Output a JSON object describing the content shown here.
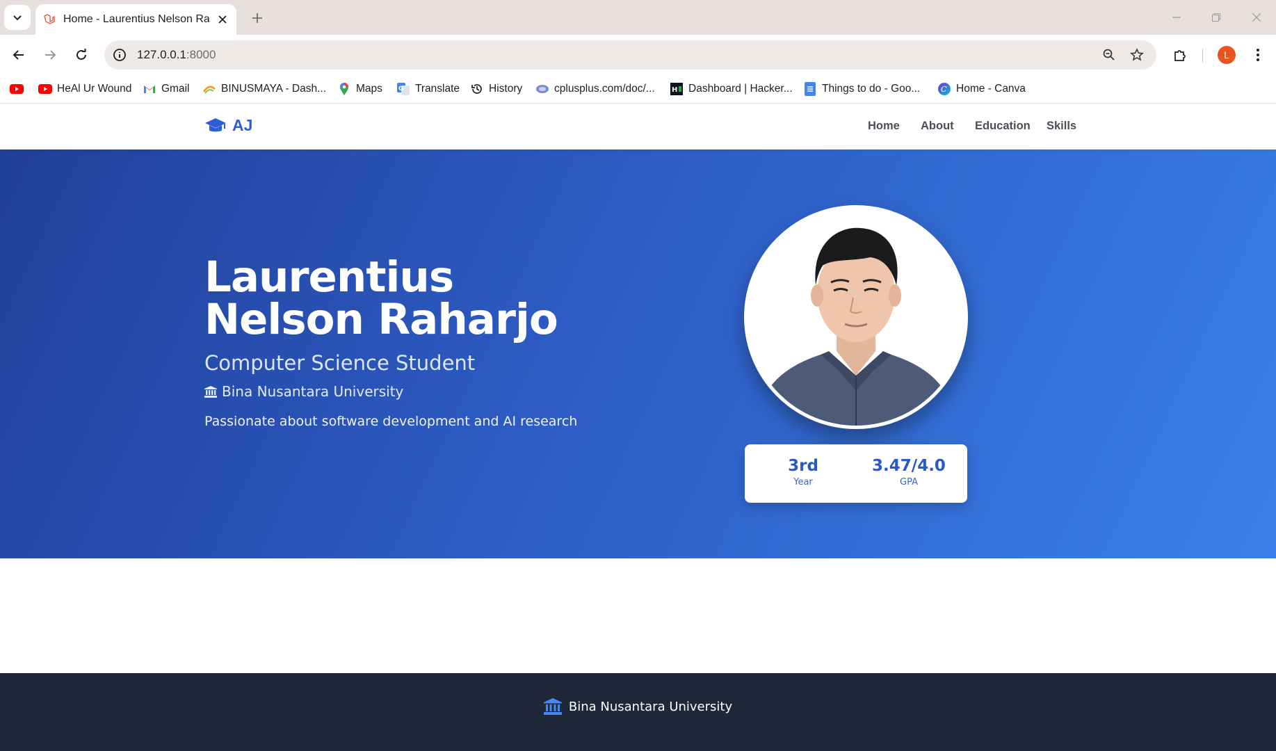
{
  "browser": {
    "tab_title": "Home - Laurentius Nelson Raharjo",
    "url_host": "127.0.0.1",
    "url_port": ":8000",
    "profile_initial": "L",
    "bookmarks": [
      {
        "label": "",
        "icon": "youtube-icon"
      },
      {
        "label": "HeAl Ur Wound",
        "icon": "youtube-icon"
      },
      {
        "label": "Gmail",
        "icon": "gmail-icon"
      },
      {
        "label": "BINUSMAYA - Dash...",
        "icon": "binusmaya-icon"
      },
      {
        "label": "Maps",
        "icon": "maps-icon"
      },
      {
        "label": "Translate",
        "icon": "translate-icon"
      },
      {
        "label": "History",
        "icon": "history-icon"
      },
      {
        "label": "cplusplus.com/doc/...",
        "icon": "cplusplus-icon"
      },
      {
        "label": "Dashboard | Hacker...",
        "icon": "hackerrank-icon"
      },
      {
        "label": "Things to do - Goo...",
        "icon": "google-docs-icon"
      },
      {
        "label": "Home - Canva",
        "icon": "canva-icon"
      }
    ]
  },
  "nav": {
    "brand": "AJ",
    "links": [
      "Home",
      "About",
      "Education",
      "Skills"
    ]
  },
  "hero": {
    "name": "Laurentius Nelson Raharjo",
    "role": "Computer Science Student",
    "university": "Bina Nusantara University",
    "tagline": "Passionate about software development and AI research"
  },
  "stats": [
    {
      "value": "3rd",
      "label": "Year"
    },
    {
      "value": "3.47/4.0",
      "label": "GPA"
    }
  ],
  "footer": {
    "university": "Bina Nusantara University"
  },
  "colors": {
    "brand": "#2e5fd1",
    "hero_start": "#213f98",
    "hero_end": "#3a7fe9",
    "footer": "#1f2838"
  }
}
